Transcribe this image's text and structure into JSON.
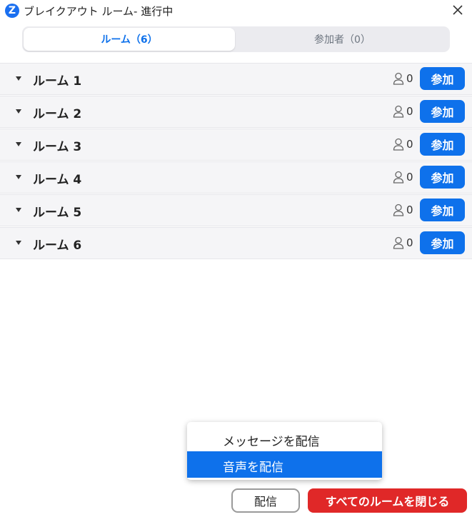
{
  "window": {
    "logo_letter": "Z",
    "title": "ブレイクアウト ルーム- 進行中",
    "close_icon": "close-icon"
  },
  "tabs": [
    {
      "label": "ルーム（6）",
      "selected": true
    },
    {
      "label": "参加者（0）",
      "selected": false
    }
  ],
  "rooms": [
    {
      "name": "ルーム 1",
      "count": "0",
      "join_label": "参加"
    },
    {
      "name": "ルーム 2",
      "count": "0",
      "join_label": "参加"
    },
    {
      "name": "ルーム 3",
      "count": "0",
      "join_label": "参加"
    },
    {
      "name": "ルーム 4",
      "count": "0",
      "join_label": "参加"
    },
    {
      "name": "ルーム 5",
      "count": "0",
      "join_label": "参加"
    },
    {
      "name": "ルーム 6",
      "count": "0",
      "join_label": "参加"
    }
  ],
  "broadcast_menu": {
    "items": [
      {
        "label": "メッセージを配信",
        "highlighted": false
      },
      {
        "label": "音声を配信",
        "highlighted": true
      }
    ]
  },
  "footer": {
    "broadcast_label": "配信",
    "close_all_label": "すべてのルームを閉じる"
  },
  "colors": {
    "accent": "#0e71eb",
    "danger": "#e02828",
    "row_background": "#f5f5f7"
  }
}
